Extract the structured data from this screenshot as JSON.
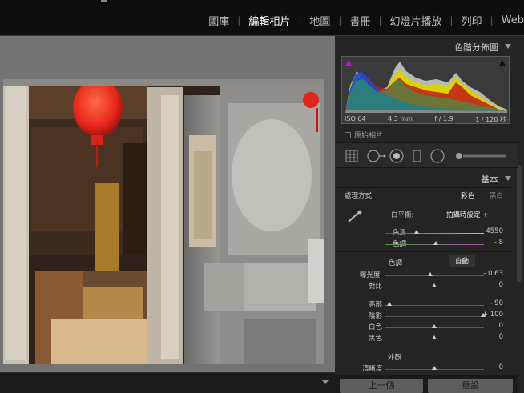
{
  "modules": [
    "圖庫",
    "編輯相片",
    "地圖",
    "書冊",
    "幻燈片播放",
    "列印",
    "Web"
  ],
  "active_module": "編輯相片",
  "histogram": {
    "title": "色階分佈圖",
    "iso": "ISO 64",
    "focal": "4.3 mm",
    "aperture": "f / 1.9",
    "shutter": "1 / 120 秒",
    "original_label": "原始相片"
  },
  "basic": {
    "title": "基本",
    "treatment_label": "處理方式:",
    "treatment_color": "彩色",
    "treatment_bw": "黑白",
    "wb_label": "白平衡:",
    "wb_value": "拍攝時設定 ÷",
    "temp_label": "色溫",
    "temp_value": "4550",
    "tint_label": "色調",
    "tint_value": "- 8",
    "tone_label": "色調",
    "auto_label": "自動",
    "exposure_label": "曝光度",
    "exposure_value": "- 0.63",
    "contrast_label": "對比",
    "contrast_value": "0",
    "highlights_label": "亮部",
    "highlights_value": "- 90",
    "shadows_label": "陰影",
    "shadows_value": "+ 100",
    "whites_label": "白色",
    "whites_value": "0",
    "blacks_label": "黑色",
    "blacks_value": "0",
    "presence_label": "外觀",
    "clarity_label": "清晰度",
    "clarity_value": "0"
  },
  "buttons": {
    "previous": "上一個",
    "reset": "重設"
  },
  "sliders": {
    "temp": 0.32,
    "tint": 0.52,
    "exposure": 0.46,
    "contrast": 0.5,
    "highlights": 0.05,
    "shadows": 0.995,
    "whites": 0.5,
    "blacks": 0.5,
    "clarity": 0.5
  },
  "icons": {
    "clip_shadow": "shadow-clipping-indicator-icon",
    "clip_highlight": "highlight-clipping-indicator-icon",
    "crop": "crop-grid-icon",
    "spot": "spot-removal-icon",
    "redeye": "red-eye-icon",
    "gradient": "graduated-filter-icon",
    "radial": "radial-filter-icon",
    "brush": "adjustment-brush-icon",
    "wb_picker": "eyedropper-icon"
  },
  "colors": {
    "accent_active": "#ffffff",
    "panel_bg": "#242424",
    "canvas_bg": "#737373"
  }
}
